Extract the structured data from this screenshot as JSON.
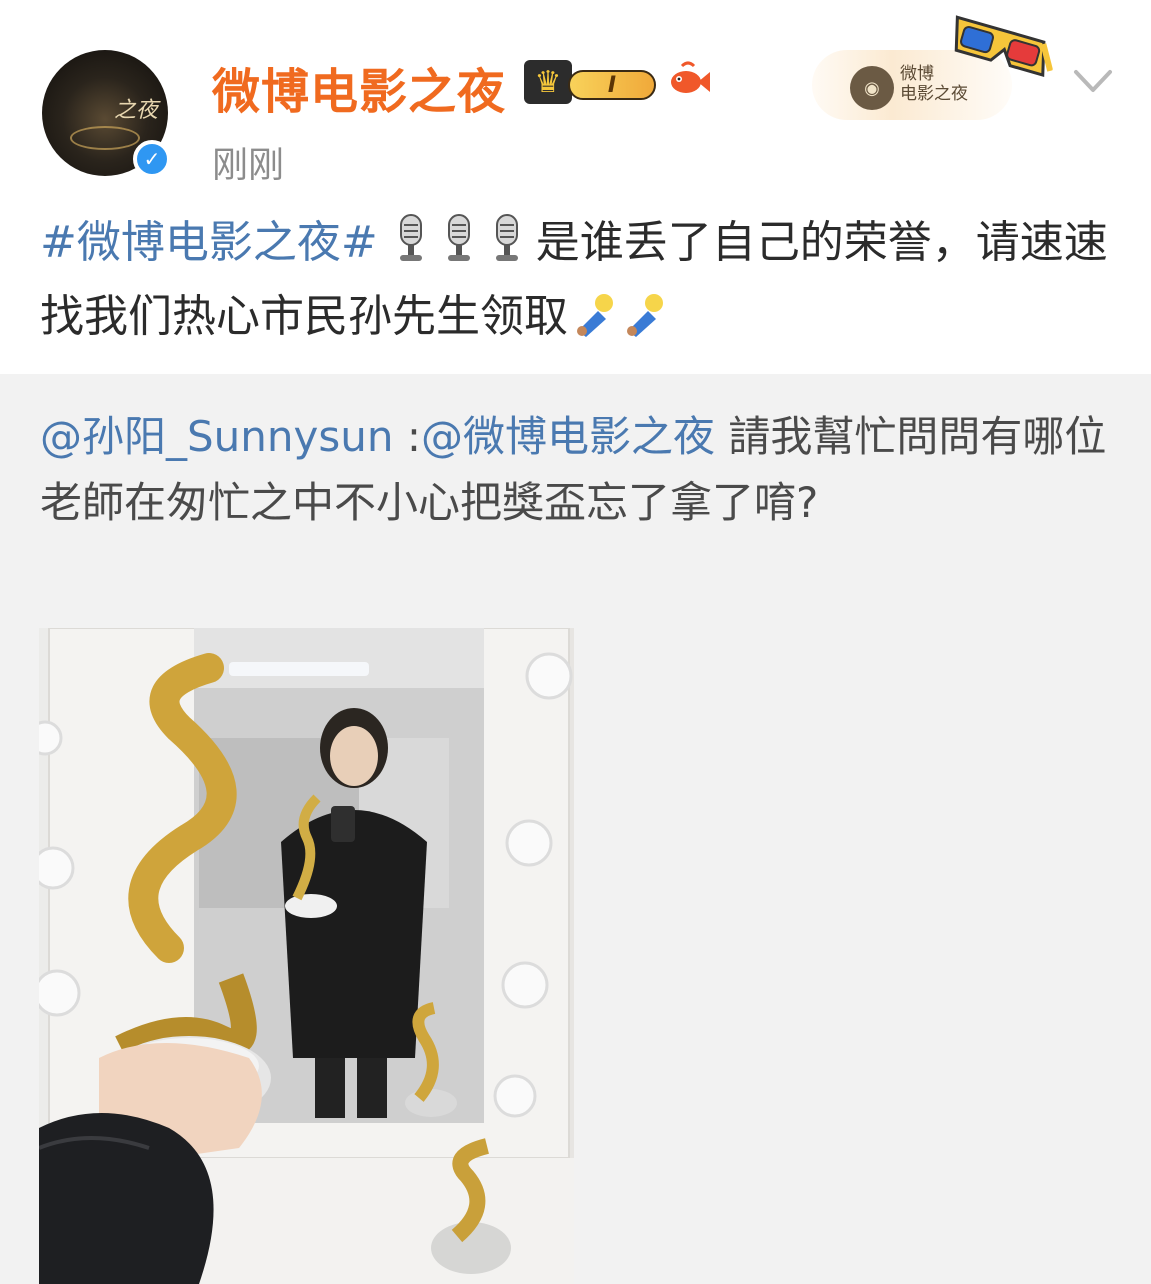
{
  "post": {
    "username": "微博电影之夜",
    "level_badge": "I",
    "timestamp": "刚刚",
    "avatar_text": "之夜",
    "text_hashtag": "#微博电影之夜#",
    "text_body": "是谁丢了自己的荣誉，请速速找我们热心市民孙先生领取"
  },
  "decoration": {
    "mark_text_line1": "微博",
    "mark_text_line2": "电影之夜"
  },
  "repost": {
    "mention_author": "@孙阳_Sunnysun",
    "separator": " :",
    "mention_target": "@微博电影之夜",
    "text": " 請我幫忙問問有哪位老師在匆忙之中不小心把獎盃忘了拿了唷?"
  },
  "icons": {
    "verified": "verified-check-icon",
    "crown": "crown-icon",
    "fish": "fish-icon",
    "microphone": "microphone-icon",
    "doll": "doll-icon",
    "chevron": "chevron-down-icon"
  },
  "colors": {
    "username": "#f06a1f",
    "hashtag": "#4a79b0",
    "mention": "#4a79b0",
    "repost_bg": "#f2f2f2",
    "verified": "#2f97f2"
  }
}
